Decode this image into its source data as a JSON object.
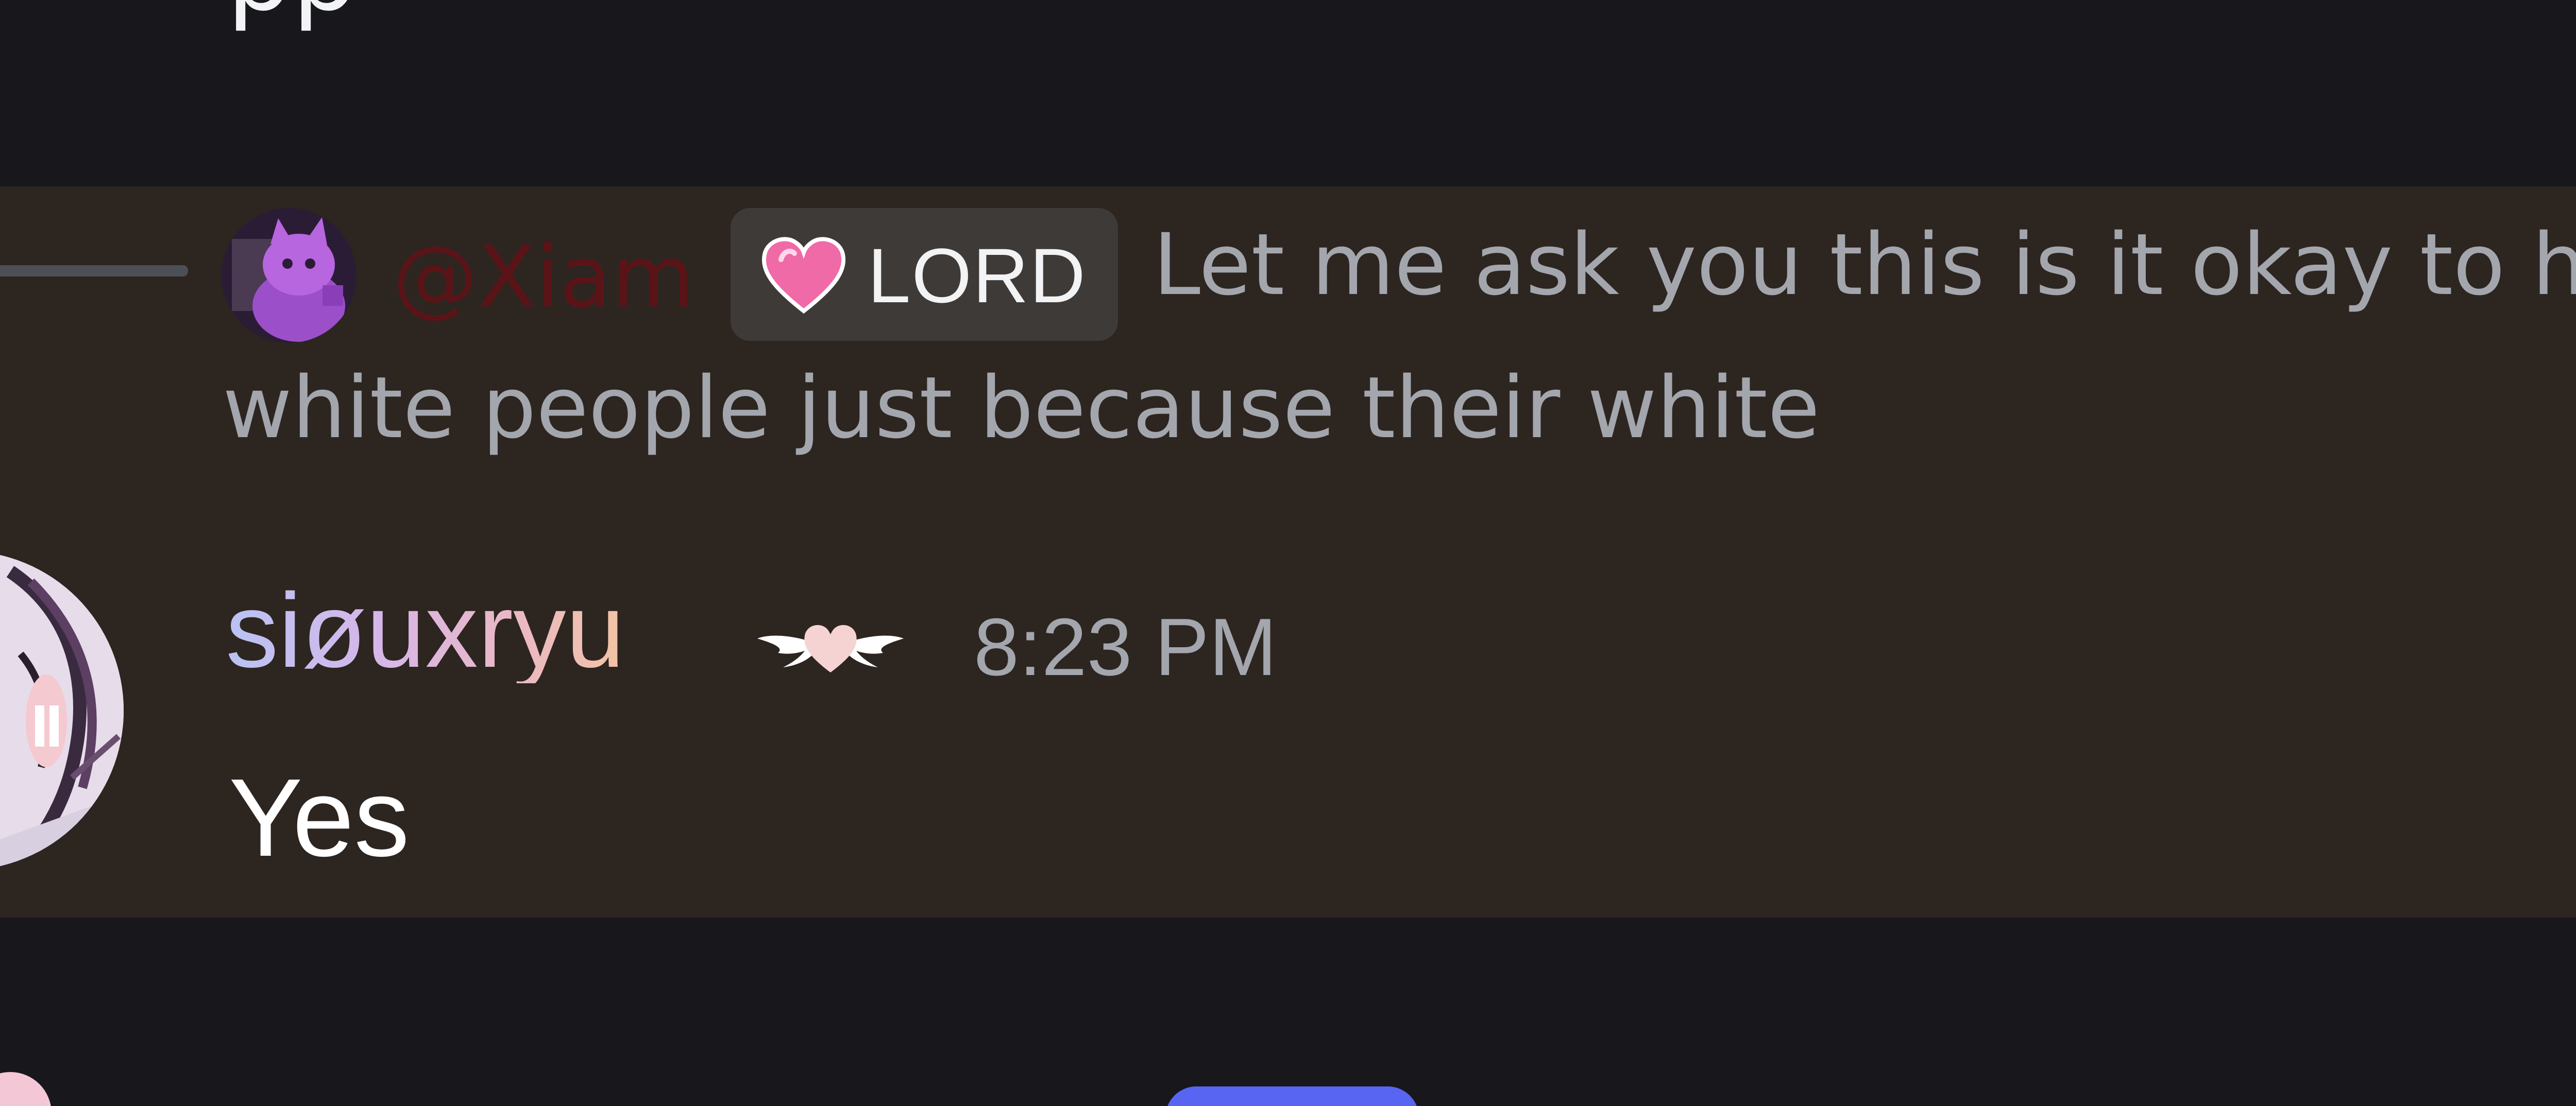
{
  "previous_message": {
    "partial_text": "pp"
  },
  "reply": {
    "author": "@Xiam",
    "role_label": "LORD",
    "role_icon": "pink-heart-icon",
    "text_line_1": "Let me ask you this is it okay to hat",
    "text_line_2": "white people just because their white"
  },
  "message": {
    "username": "siøuxryu",
    "user_badge": "winged-heart-icon",
    "timestamp": "8:23 PM",
    "body": "Yes"
  },
  "colors": {
    "background": "#17171c",
    "mention_highlight": "#2d2520",
    "reply_author": "#5a1418",
    "accent_button": "#5865f2",
    "muted_text": "#a3a6ad"
  }
}
